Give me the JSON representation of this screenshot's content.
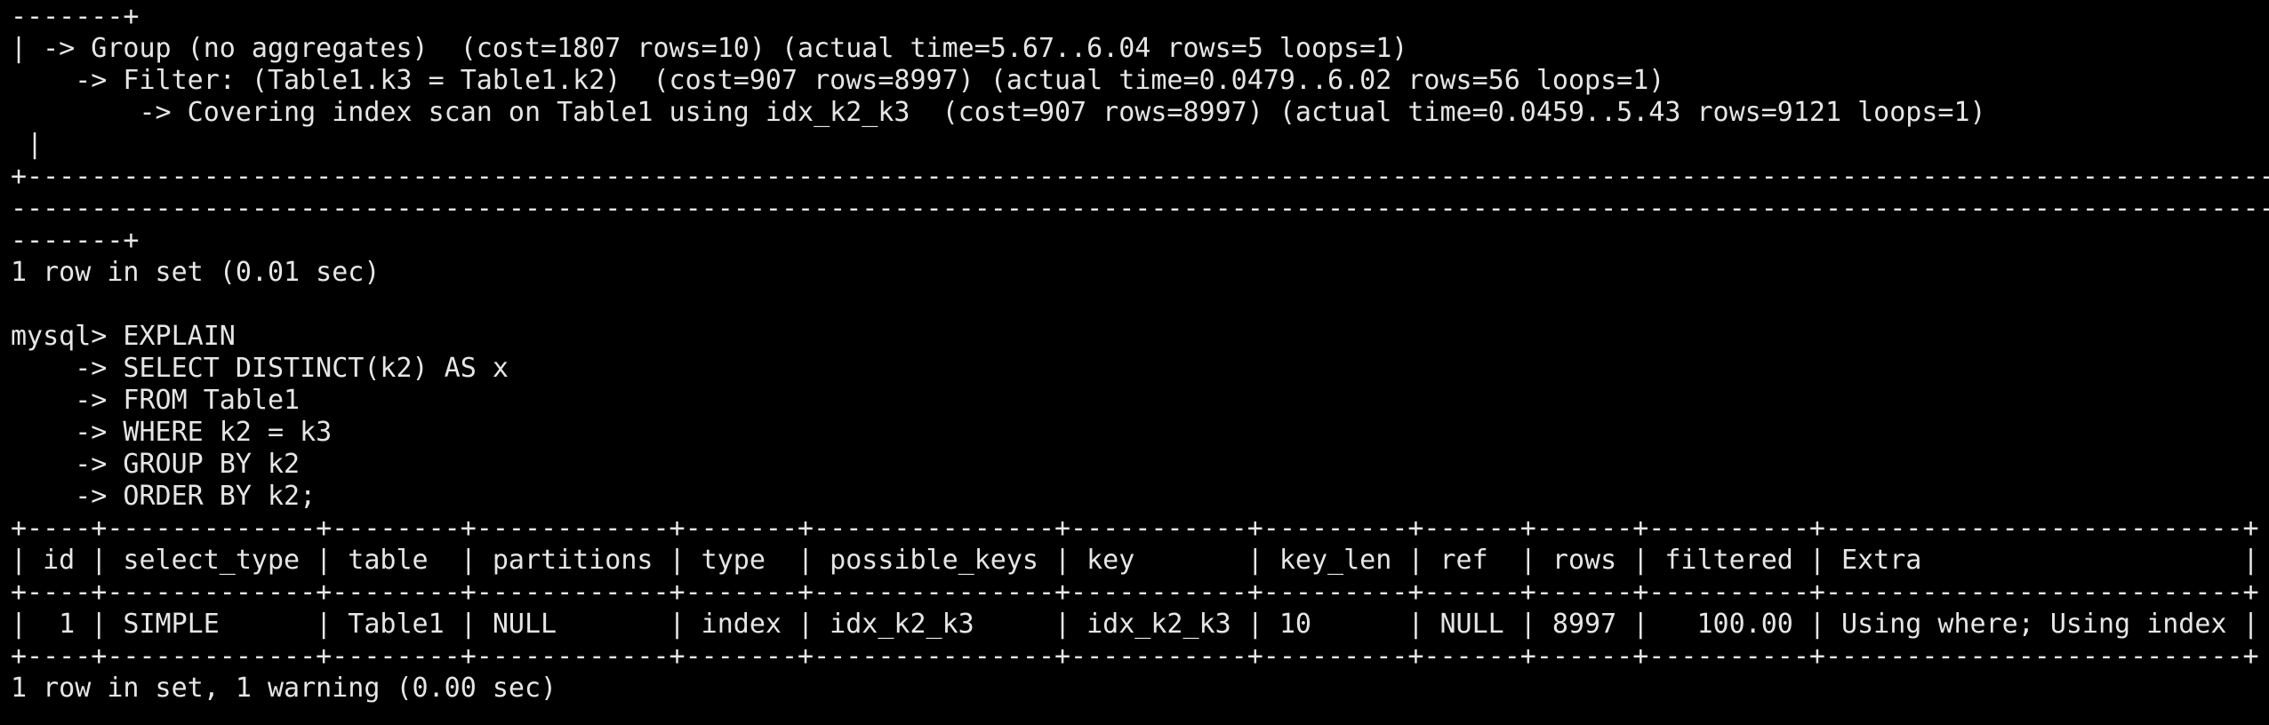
{
  "terminal": {
    "background": "#000000",
    "foreground": "#e6e6e6",
    "lines": [
      "-------+",
      "| -> Group (no aggregates)  (cost=1807 rows=10) (actual time=5.67..6.04 rows=5 loops=1)",
      "    -> Filter: (Table1.k3 = Table1.k2)  (cost=907 rows=8997) (actual time=0.0479..6.02 rows=56 loops=1)",
      "        -> Covering index scan on Table1 using idx_k2_k3  (cost=907 rows=8997) (actual time=0.0459..5.43 rows=9121 loops=1)",
      " |",
      "+-------------------------------------------------------------------------------------------------------------------------------------------------",
      "--------------------------------------------------------------------------------------------------------------------------------------------------",
      "-------+",
      "1 row in set (0.01 sec)",
      "",
      "mysql> EXPLAIN",
      "    -> SELECT DISTINCT(k2) AS x",
      "    -> FROM Table1",
      "    -> WHERE k2 = k3",
      "    -> GROUP BY k2",
      "    -> ORDER BY k2;",
      "+----+-------------+--------+------------+-------+---------------+-----------+---------+------+------+----------+--------------------------+",
      "| id | select_type | table  | partitions | type  | possible_keys | key       | key_len | ref  | rows | filtered | Extra                    |",
      "+----+-------------+--------+------------+-------+---------------+-----------+---------+------+------+----------+--------------------------+",
      "|  1 | SIMPLE      | Table1 | NULL       | index | idx_k2_k3     | idx_k2_k3 | 10      | NULL | 8997 |   100.00 | Using where; Using index |",
      "+----+-------------+--------+------------+-------+---------------+-----------+---------+------+------+----------+--------------------------+",
      "1 row in set, 1 warning (0.00 sec)"
    ]
  }
}
